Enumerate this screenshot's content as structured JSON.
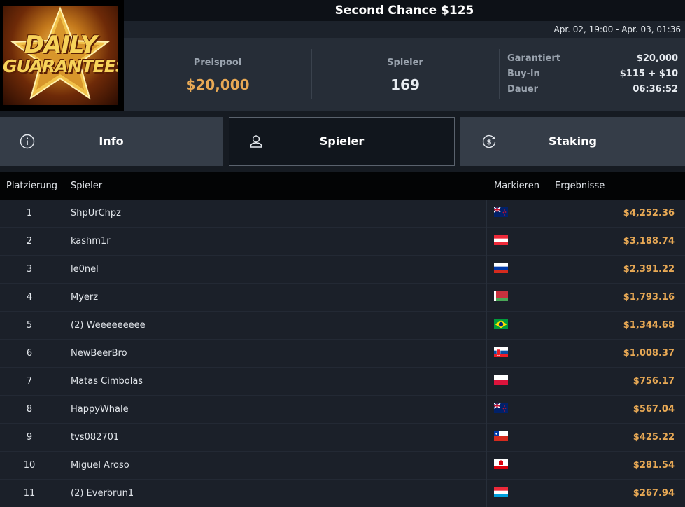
{
  "logo": {
    "line1": "DAILY",
    "line2": "GUARANTEES"
  },
  "header": {
    "title": "Second Chance $125",
    "date_range": "Apr. 02, 19:00 - Apr. 03, 01:36"
  },
  "stats": {
    "prizepool_label": "Preispool",
    "prizepool_value": "$20,000",
    "players_label": "Spieler",
    "players_value": "169",
    "details": [
      {
        "label": "Garantiert",
        "value": "$20,000"
      },
      {
        "label": "Buy-in",
        "value": "$115 + $10"
      },
      {
        "label": "Dauer",
        "value": "06:36:52"
      }
    ]
  },
  "tabs": [
    {
      "label": "Info",
      "icon": "info-icon"
    },
    {
      "label": "Spieler",
      "icon": "user-icon",
      "active": true
    },
    {
      "label": "Staking",
      "icon": "dollar-cycle-icon"
    }
  ],
  "table": {
    "columns": [
      "Platzierung",
      "Spieler",
      "Markieren",
      "Ergebnisse"
    ],
    "rows": [
      {
        "place": "1",
        "player": "ShpUrChpz",
        "flag": "new-zealand",
        "result": "$4,252.36"
      },
      {
        "place": "2",
        "player": "kashm1r",
        "flag": "austria",
        "result": "$3,188.74"
      },
      {
        "place": "3",
        "player": "le0nel",
        "flag": "russia",
        "result": "$2,391.22"
      },
      {
        "place": "4",
        "player": "Myerz",
        "flag": "belarus",
        "result": "$1,793.16"
      },
      {
        "place": "5",
        "player": "(2) Weeeeeeeee",
        "flag": "brazil",
        "result": "$1,344.68"
      },
      {
        "place": "6",
        "player": "NewBeerBro",
        "flag": "slovakia",
        "result": "$1,008.37"
      },
      {
        "place": "7",
        "player": "Matas Cimbolas",
        "flag": "poland",
        "result": "$756.17"
      },
      {
        "place": "8",
        "player": "HappyWhale",
        "flag": "new-zealand",
        "result": "$567.04"
      },
      {
        "place": "9",
        "player": "tvs082701",
        "flag": "chile",
        "result": "$425.22"
      },
      {
        "place": "10",
        "player": "Miguel Aroso",
        "flag": "gibraltar",
        "result": "$281.54"
      },
      {
        "place": "11",
        "player": "(2) Everbrun1",
        "flag": "luxembourg",
        "result": "$267.94"
      }
    ]
  },
  "colors": {
    "accent": "#e8a955",
    "background": "#161b22",
    "tab": "#353d48",
    "tab_active": "#11161d"
  }
}
